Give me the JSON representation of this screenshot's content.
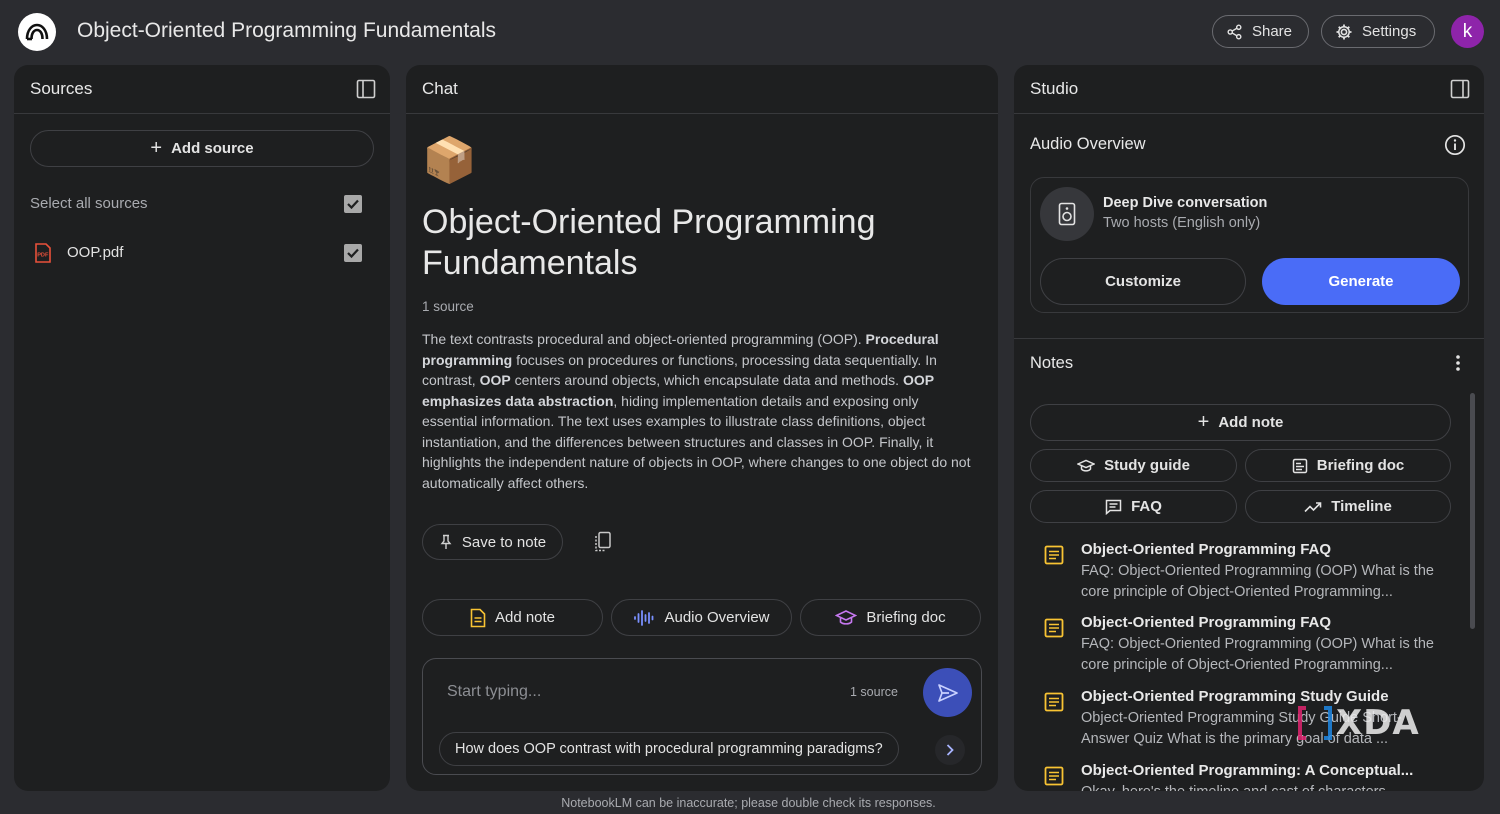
{
  "header": {
    "title": "Object-Oriented Programming Fundamentals",
    "share_label": "Share",
    "settings_label": "Settings",
    "avatar_initial": "k"
  },
  "sources": {
    "title": "Sources",
    "add_source_label": "Add source",
    "select_all_label": "Select all sources",
    "items": [
      {
        "name": "OOP.pdf",
        "icon": "pdf-icon",
        "checked": true
      }
    ]
  },
  "chat": {
    "title": "Chat",
    "emoji": "📦",
    "notebook_title": "Object-Oriented Programming Fundamentals",
    "source_count": "1 source",
    "summary": [
      {
        "t": "The text contrasts procedural and object-oriented programming (OOP). ",
        "b": false
      },
      {
        "t": "Procedural programming",
        "b": true
      },
      {
        "t": " focuses on procedures or functions, processing data sequentially. In contrast, ",
        "b": false
      },
      {
        "t": "OOP",
        "b": true
      },
      {
        "t": " centers around objects, which encapsulate data and methods. ",
        "b": false
      },
      {
        "t": "OOP emphasizes data abstraction",
        "b": true
      },
      {
        "t": ", hiding implementation details and exposing only essential information. The text uses examples to illustrate class definitions, object instantiation, and the differences between structures and classes in OOP. Finally, it highlights the independent nature of objects in OOP, where changes to one object do not automatically affect others.",
        "b": false
      }
    ],
    "save_to_note_label": "Save to note",
    "actions": {
      "add_note": "Add note",
      "audio_overview": "Audio Overview",
      "briefing_doc": "Briefing doc"
    },
    "input_placeholder": "Start typing...",
    "input_source_count": "1 source",
    "suggestion": "How does OOP contrast with procedural programming paradigms?"
  },
  "studio": {
    "title": "Studio",
    "audio_overview_title": "Audio Overview",
    "deep_dive_title": "Deep Dive conversation",
    "deep_dive_subtitle": "Two hosts (English only)",
    "customize_label": "Customize",
    "generate_label": "Generate",
    "notes_title": "Notes",
    "add_note_label": "Add note",
    "study_guide_label": "Study guide",
    "briefing_doc_label": "Briefing doc",
    "faq_label": "FAQ",
    "timeline_label": "Timeline",
    "notes": [
      {
        "title": "Object-Oriented Programming FAQ",
        "body": "FAQ: Object-Oriented Programming (OOP) What is the core principle of Object-Oriented Programming..."
      },
      {
        "title": "Object-Oriented Programming FAQ",
        "body": "FAQ: Object-Oriented Programming (OOP) What is the core principle of Object-Oriented Programming..."
      },
      {
        "title": "Object-Oriented Programming Study Guide",
        "body": "Object-Oriented Programming Study Guide Short-Answer Quiz What is the primary goal of data ..."
      },
      {
        "title": "Object-Oriented Programming: A Conceptual...",
        "body": "Okay, here's the timeline and cast of characters"
      }
    ]
  },
  "footer": {
    "disclaimer": "NotebookLM can be inaccurate; please double check its responses."
  },
  "watermark": {
    "text": "XDA"
  },
  "colors": {
    "accent": "#4a6cf7",
    "send_button": "#3c4fb8",
    "note_icon": "#f9c433",
    "pdf_icon": "#e8503a"
  }
}
